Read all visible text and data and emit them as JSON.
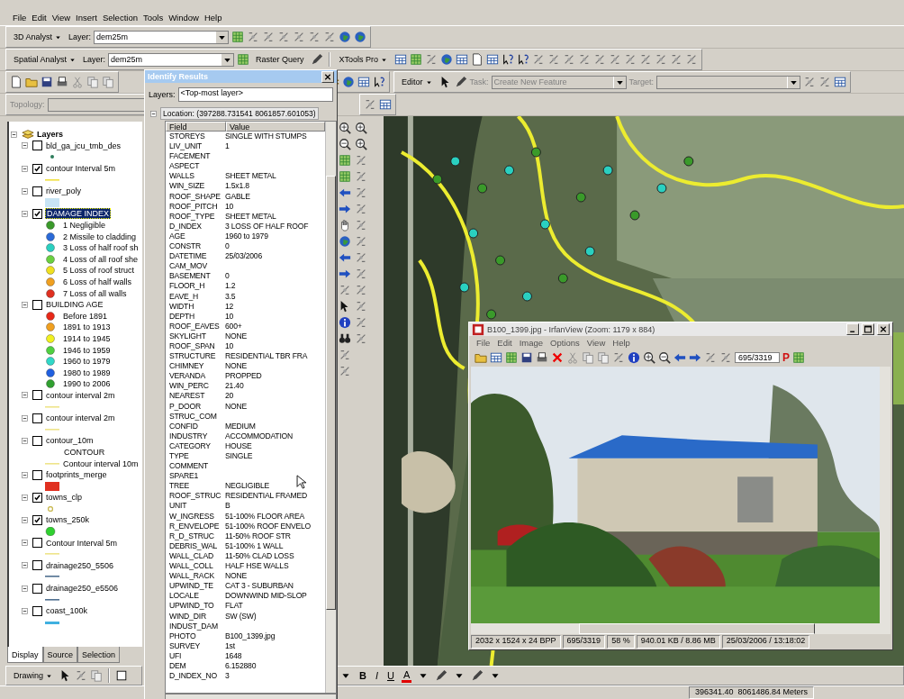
{
  "menu_bar": [
    "File",
    "Edit",
    "View",
    "Insert",
    "Selection",
    "Tools",
    "Window",
    "Help"
  ],
  "analyst_3d": {
    "menu": "3D Analyst",
    "layer_label": "Layer:",
    "layer_value": "dem25m"
  },
  "spatial_analyst": {
    "menu": "Spatial Analyst",
    "layer_label": "Layer:",
    "layer_value": "dem25m",
    "raster_query": "Raster Query",
    "xtools": "XTools Pro"
  },
  "editor": {
    "menu": "Editor",
    "task_label": "Task:",
    "task_value": "Create New Feature",
    "target_label": "Target:"
  },
  "topology": {
    "label": "Topology:"
  },
  "toc": {
    "root": "Layers",
    "layers": [
      {
        "name": "bld_ga_jcu_tmb_des",
        "checked": false,
        "selected": false,
        "legend": [
          {
            "kind": "point",
            "color": "#2e7d5b"
          }
        ]
      },
      {
        "name": "contour Interval 5m",
        "checked": true,
        "selected": false,
        "legend": [
          {
            "kind": "line",
            "color": "#f0e040"
          }
        ]
      },
      {
        "name": "river_poly",
        "checked": false,
        "selected": false,
        "legend": [
          {
            "kind": "fill",
            "color": "#c8e4f4"
          }
        ]
      },
      {
        "name": "DAMAGE INDEX",
        "checked": true,
        "selected": true,
        "legend": [
          {
            "kind": "circle",
            "color": "#3a9a2a",
            "label": "1 Negligible"
          },
          {
            "kind": "circle",
            "color": "#2a6ad8",
            "label": "2 Missile to cladding"
          },
          {
            "kind": "circle",
            "color": "#2ad0c0",
            "label": "3 Loss of half roof sh"
          },
          {
            "kind": "circle",
            "color": "#6ad040",
            "label": "4 Loss of all roof she"
          },
          {
            "kind": "circle",
            "color": "#f0e020",
            "label": "5 Loss of roof struct"
          },
          {
            "kind": "circle",
            "color": "#f0a020",
            "label": "6 Loss of half walls"
          },
          {
            "kind": "circle",
            "color": "#e03020",
            "label": "7 Loss of all walls"
          }
        ]
      },
      {
        "name": "BUILDING AGE",
        "checked": false,
        "selected": false,
        "legend": [
          {
            "kind": "circle",
            "color": "#e82818",
            "label": "Before 1891"
          },
          {
            "kind": "circle",
            "color": "#f0a020",
            "label": "1891 to 1913"
          },
          {
            "kind": "circle",
            "color": "#f0f020",
            "label": "1914 to 1945"
          },
          {
            "kind": "circle",
            "color": "#50d040",
            "label": "1946 to 1959"
          },
          {
            "kind": "circle",
            "color": "#30d8c8",
            "label": "1960 to 1979"
          },
          {
            "kind": "circle",
            "color": "#2060e0",
            "label": "1980 to 1989"
          },
          {
            "kind": "circle",
            "color": "#30a030",
            "label": "1990 to 2006"
          }
        ]
      },
      {
        "name": "contour interval 2m",
        "checked": false,
        "selected": false,
        "legend": [
          {
            "kind": "line",
            "color": "#eee48a"
          }
        ]
      },
      {
        "name": "contour interval 2m",
        "checked": false,
        "selected": false,
        "legend": [
          {
            "kind": "line",
            "color": "#eee48a"
          }
        ]
      },
      {
        "name": "contour_10m",
        "checked": false,
        "selected": false,
        "heading": "CONTOUR",
        "legend": [
          {
            "kind": "line",
            "color": "#eee48a",
            "label": "Contour interval 10m"
          }
        ]
      },
      {
        "name": "footprints_merge",
        "checked": false,
        "selected": false,
        "legend": [
          {
            "kind": "fill",
            "color": "#e03020"
          }
        ]
      },
      {
        "name": "towns_clp",
        "checked": true,
        "selected": false,
        "legend": [
          {
            "kind": "ring",
            "color": "#c8b850"
          }
        ]
      },
      {
        "name": "towns_250k",
        "checked": true,
        "selected": false,
        "legend": [
          {
            "kind": "circle",
            "color": "#30d030"
          }
        ]
      },
      {
        "name": "Contour Interval 5m",
        "checked": false,
        "selected": false,
        "legend": [
          {
            "kind": "line",
            "color": "#eee48a"
          }
        ]
      },
      {
        "name": "drainage250_5506",
        "checked": false,
        "selected": false,
        "legend": [
          {
            "kind": "line",
            "color": "#507090"
          }
        ]
      },
      {
        "name": "drainage250_e5506",
        "checked": false,
        "selected": false,
        "legend": [
          {
            "kind": "line",
            "color": "#507090"
          }
        ]
      },
      {
        "name": "coast_100k",
        "checked": false,
        "selected": false,
        "legend": [
          {
            "kind": "line",
            "color": "#40b0e0"
          }
        ]
      }
    ]
  },
  "toc_tabs": [
    {
      "label": "Display",
      "selected": true
    },
    {
      "label": "Source",
      "selected": false
    },
    {
      "label": "Selection",
      "selected": false
    }
  ],
  "drawing_toolbar": {
    "menu": "Drawing"
  },
  "text_toolbar": {
    "bold": "B",
    "italic": "I",
    "underline": "U",
    "font_color": "A"
  },
  "identify": {
    "title": "Identify Results",
    "layers_label": "Layers:",
    "layers_value": "<Top-most layer>",
    "location": "Location: (397288.731541 8061857.601053)",
    "columns": [
      "Field",
      "Value"
    ],
    "rows": [
      [
        "STOREYS",
        "SINGLE WITH STUMPS"
      ],
      [
        "LIV_UNIT",
        "1"
      ],
      [
        "FACEMENT",
        ""
      ],
      [
        "ASPECT",
        ""
      ],
      [
        "WALLS",
        "SHEET METAL"
      ],
      [
        "WIN_SIZE",
        "1.5x1.8"
      ],
      [
        "ROOF_SHAPE",
        "GABLE"
      ],
      [
        "ROOF_PITCH",
        "10"
      ],
      [
        "ROOF_TYPE",
        "SHEET METAL"
      ],
      [
        "D_INDEX",
        "3 LOSS OF HALF ROOF"
      ],
      [
        "AGE",
        "1960 to 1979"
      ],
      [
        "CONSTR",
        "0"
      ],
      [
        "DATETIME",
        "25/03/2006"
      ],
      [
        "CAM_MOV",
        ""
      ],
      [
        "BASEMENT",
        "0"
      ],
      [
        "FLOOR_H",
        "1.2"
      ],
      [
        "EAVE_H",
        "3.5"
      ],
      [
        "WIDTH",
        "12"
      ],
      [
        "DEPTH",
        "10"
      ],
      [
        "ROOF_EAVES",
        "600+"
      ],
      [
        "SKYLIGHT",
        "NONE"
      ],
      [
        "ROOF_SPAN",
        "10"
      ],
      [
        "STRUCTURE",
        "RESIDENTIAL TBR FRA"
      ],
      [
        "CHIMNEY",
        "NONE"
      ],
      [
        "VERANDA",
        "PROPPED"
      ],
      [
        "WIN_PERC",
        "21.40"
      ],
      [
        "NEAREST",
        "20"
      ],
      [
        "P_DOOR",
        "NONE"
      ],
      [
        "STRUC_COM",
        ""
      ],
      [
        "CONFID",
        "MEDIUM"
      ],
      [
        "INDUSTRY",
        "ACCOMMODATION"
      ],
      [
        "CATEGORY",
        "HOUSE"
      ],
      [
        "TYPE",
        "SINGLE"
      ],
      [
        "COMMENT",
        ""
      ],
      [
        "SPARE1",
        ""
      ],
      [
        "TREE",
        "NEGLIGIBLE"
      ],
      [
        "ROOF_STRUC",
        "RESIDENTIAL FRAMED"
      ],
      [
        "UNIT",
        "B"
      ],
      [
        "W_INGRESS",
        "51-100% FLOOR AREA"
      ],
      [
        "R_ENVELOPE",
        "51-100% ROOF ENVELO"
      ],
      [
        "R_D_STRUC",
        "11-50% ROOF STR"
      ],
      [
        "DEBRIS_WAL",
        "51-100% 1 WALL"
      ],
      [
        "WALL_CLAD",
        "11-50% CLAD LOSS"
      ],
      [
        "WALL_COLL",
        "HALF HSE WALLS"
      ],
      [
        "WALL_RACK",
        "NONE"
      ],
      [
        "UPWIND_TE",
        "CAT 3 - SUBURBAN"
      ],
      [
        "LOCALE",
        "DOWNWIND MID-SLOP"
      ],
      [
        "UPWIND_TO",
        "FLAT"
      ],
      [
        "WIND_DIR",
        "SW (SW)"
      ],
      [
        "INDUST_DAM",
        ""
      ],
      [
        "PHOTO",
        "B100_1399.jpg"
      ],
      [
        "SURVEY",
        "1st"
      ],
      [
        "UFI",
        "1648"
      ],
      [
        "DEM",
        "6.152880"
      ],
      [
        "D_INDEX_NO",
        "3"
      ]
    ]
  },
  "viewer": {
    "title": "B100_1399.jpg - IrfanView (Zoom: 1179 x 884)",
    "menu": [
      "File",
      "Edit",
      "Image",
      "Options",
      "View",
      "Help"
    ],
    "page_field": "695/3319",
    "plugin_letter": "P",
    "status": [
      "2032 x 1524 x 24 BPP",
      "695/3319",
      "58 %",
      "940.01 KB / 8.86 MB",
      "25/03/2006 / 13:18:02"
    ]
  },
  "status_bar": {
    "coordinates": "396341.40  8061486.84 Meters"
  }
}
